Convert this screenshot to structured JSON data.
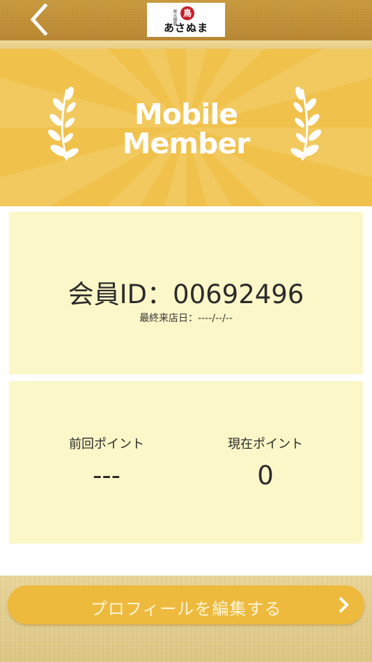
{
  "header": {
    "logo": {
      "sub": "炭火焼鳥",
      "seal": "鳥",
      "text": "あさぬま"
    }
  },
  "banner": {
    "title_line1": "Mobile",
    "title_line2": "Member"
  },
  "member": {
    "id_text": "会員ID：00692496",
    "last_visit": "最終来店日：----/--/--"
  },
  "points": {
    "previous_label": "前回ポイント",
    "previous_value": "---",
    "current_label": "現在ポイント",
    "current_value": "0"
  },
  "footer": {
    "edit_profile_label": "プロフィールを編集する"
  },
  "colors": {
    "banner": "#f0c14b",
    "card": "#fcf7c8",
    "button": "#eeba3e",
    "header": "#c99a3c"
  }
}
